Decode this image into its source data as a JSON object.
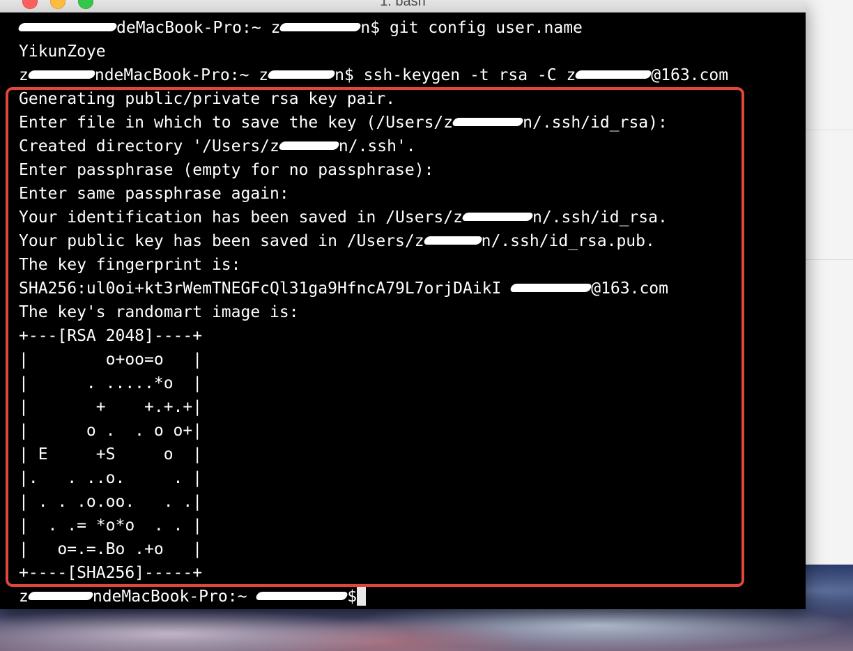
{
  "window": {
    "title": "1. bash"
  },
  "edge_marks": [
    "0",
    "2",
    "1",
    "1",
    "1"
  ],
  "terminal": {
    "lines": [
      {
        "pre": "",
        "redact1": 140,
        "mid": "deMacBook-Pro:~ z",
        "redact2": 115,
        "post": "n$ git config user.name"
      },
      {
        "text": "YikunZoye"
      },
      {
        "pre": "z",
        "redact1": 95,
        "mid": "ndeMacBook-Pro:~ z",
        "redact2": 95,
        "post": "n$ ssh-keygen -t rsa -C z",
        "redact3": 108,
        "post2": "@163.com"
      },
      {
        "text": "Generating public/private rsa key pair."
      },
      {
        "pre": "Enter file in which to save the key (/Users/z",
        "redact1": 100,
        "mid": "n/.ssh/id_rsa):"
      },
      {
        "pre": "Created directory '/Users/z",
        "redact1": 85,
        "mid": "n/.ssh'."
      },
      {
        "text": "Enter passphrase (empty for no passphrase):"
      },
      {
        "text": "Enter same passphrase again:"
      },
      {
        "pre": "Your identification has been saved in /Users/z",
        "redact1": 100,
        "mid": "n/.ssh/id_rsa."
      },
      {
        "pre": "Your public key has been saved in /Users/z",
        "redact1": 82,
        "mid": "n/.ssh/id_rsa.pub."
      },
      {
        "text": "The key fingerprint is:"
      },
      {
        "pre": "SHA256:ul0oi+kt3rWemTNEGFcQl31ga9HfncA79L7orjDAikI ",
        "redact1": 115,
        "mid": "@163.com"
      },
      {
        "text": "The key's randomart image is:"
      },
      {
        "text": "+---[RSA 2048]----+"
      },
      {
        "text": "|        o+oo=o   |"
      },
      {
        "text": "|      . .....*o  |"
      },
      {
        "text": "|       +    +.+.+|"
      },
      {
        "text": "|      o .  . o o+|"
      },
      {
        "text": "| E     +S     o  |"
      },
      {
        "text": "|.   . ..o.     . |"
      },
      {
        "text": "| . . .o.oo.   . .|"
      },
      {
        "text": "|  . .= *o*o  . . |"
      },
      {
        "text": "|   o=.=.Bo .+o   |"
      },
      {
        "text": "+----[SHA256]-----+"
      },
      {
        "pre": "z",
        "redact1": 92,
        "mid": "ndeMacBook-Pro:~ ",
        "redact2": 130,
        "post": "$",
        "cursor": true
      }
    ]
  }
}
